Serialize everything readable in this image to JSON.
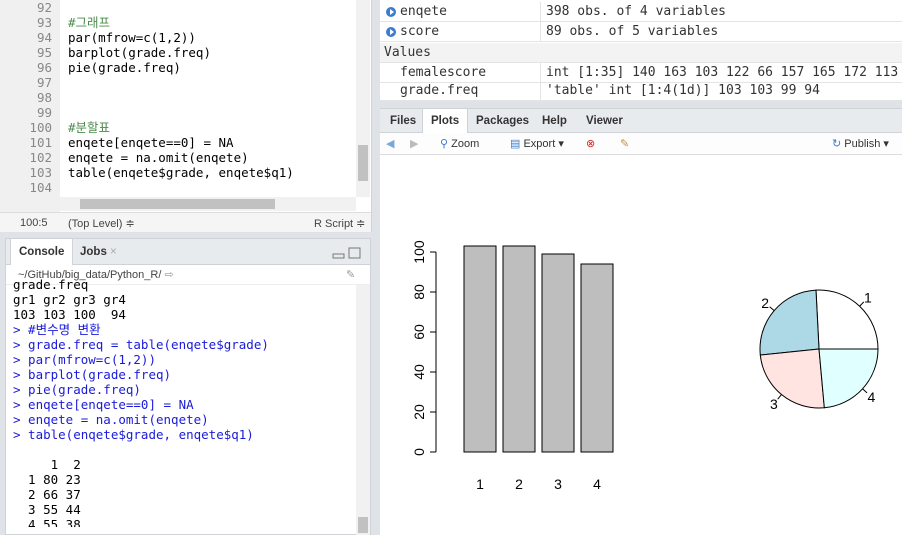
{
  "editor": {
    "lines": [
      {
        "num": "92",
        "code": ""
      },
      {
        "num": "93",
        "code": "#그래프"
      },
      {
        "num": "94",
        "code": "par(mfrow=c(1,2))"
      },
      {
        "num": "95",
        "code": "barplot(grade.freq)"
      },
      {
        "num": "96",
        "code": "pie(grade.freq)"
      },
      {
        "num": "97",
        "code": ""
      },
      {
        "num": "98",
        "code": ""
      },
      {
        "num": "99",
        "code": ""
      },
      {
        "num": "100",
        "code": "#분할표"
      },
      {
        "num": "101",
        "code": "enqete[enqete==0] = NA"
      },
      {
        "num": "102",
        "code": "enqete = na.omit(enqete)"
      },
      {
        "num": "103",
        "code": "table(enqete$grade, enqete$q1)"
      },
      {
        "num": "104",
        "code": ""
      }
    ],
    "status": {
      "position": "100:5",
      "scope": "(Top Level) ≑",
      "filetype": "R Script ≑"
    }
  },
  "console": {
    "tabs": [
      "Console",
      "Jobs"
    ],
    "path": "~/GitHub/big_data/Python_R/",
    "lines": [
      {
        "text": "grade.freq",
        "type": "out"
      },
      {
        "text": "gr1 gr2 gr3 gr4",
        "type": "out"
      },
      {
        "text": "103 103 100  94",
        "type": "out"
      },
      {
        "text": "> #변수명 변환",
        "type": "in"
      },
      {
        "text": "> grade.freq = table(enqete$grade)",
        "type": "in"
      },
      {
        "text": "> par(mfrow=c(1,2))",
        "type": "in"
      },
      {
        "text": "> barplot(grade.freq)",
        "type": "in"
      },
      {
        "text": "> pie(grade.freq)",
        "type": "in"
      },
      {
        "text": "> enqete[enqete==0] = NA",
        "type": "in"
      },
      {
        "text": "> enqete = na.omit(enqete)",
        "type": "in"
      },
      {
        "text": "> table(enqete$grade, enqete$q1)",
        "type": "in"
      },
      {
        "text": "",
        "type": "out"
      },
      {
        "text": "     1  2",
        "type": "out"
      },
      {
        "text": "  1 80 23",
        "type": "out"
      },
      {
        "text": "  2 66 37",
        "type": "out"
      },
      {
        "text": "  3 55 44",
        "type": "out"
      },
      {
        "text": "  4 55 38",
        "type": "out"
      },
      {
        "text": "> ",
        "type": "in"
      }
    ]
  },
  "environment": {
    "data_rows": [
      {
        "name": "enqete",
        "value": "398 obs. of 4 variables"
      },
      {
        "name": "score",
        "value": "89 obs. of 5 variables"
      }
    ],
    "values_header": "Values",
    "value_rows": [
      {
        "name": "femalescore",
        "value": "int [1:35] 140 163 103 122 66 157 165 172 113"
      },
      {
        "name": "grade.freq",
        "value": "'table' int [1:4(1d)] 103 103 99 94"
      }
    ]
  },
  "plots_pane": {
    "tabs": [
      "Files",
      "Plots",
      "Packages",
      "Help",
      "Viewer"
    ],
    "active_tab": "Plots",
    "toolbar": {
      "zoom": "Zoom",
      "export": "Export ▾",
      "publish": "Publish ▾"
    }
  },
  "chart_data": [
    {
      "type": "bar",
      "categories": [
        "1",
        "2",
        "3",
        "4"
      ],
      "values": [
        103,
        103,
        99,
        94
      ],
      "ylim": [
        0,
        110
      ],
      "yticks": [
        0,
        20,
        40,
        60,
        80,
        100
      ],
      "bar_color": "#bebebe"
    },
    {
      "type": "pie",
      "labels": [
        "1",
        "2",
        "3",
        "4"
      ],
      "values": [
        103,
        103,
        99,
        94
      ],
      "colors": [
        "#ffffff",
        "#add8e6",
        "#ffe4e1",
        "#e0ffff"
      ]
    }
  ],
  "colors": {
    "accent": "#3a7ccf",
    "input_text": "#1a1adb",
    "comment": "#4a8c4a"
  }
}
